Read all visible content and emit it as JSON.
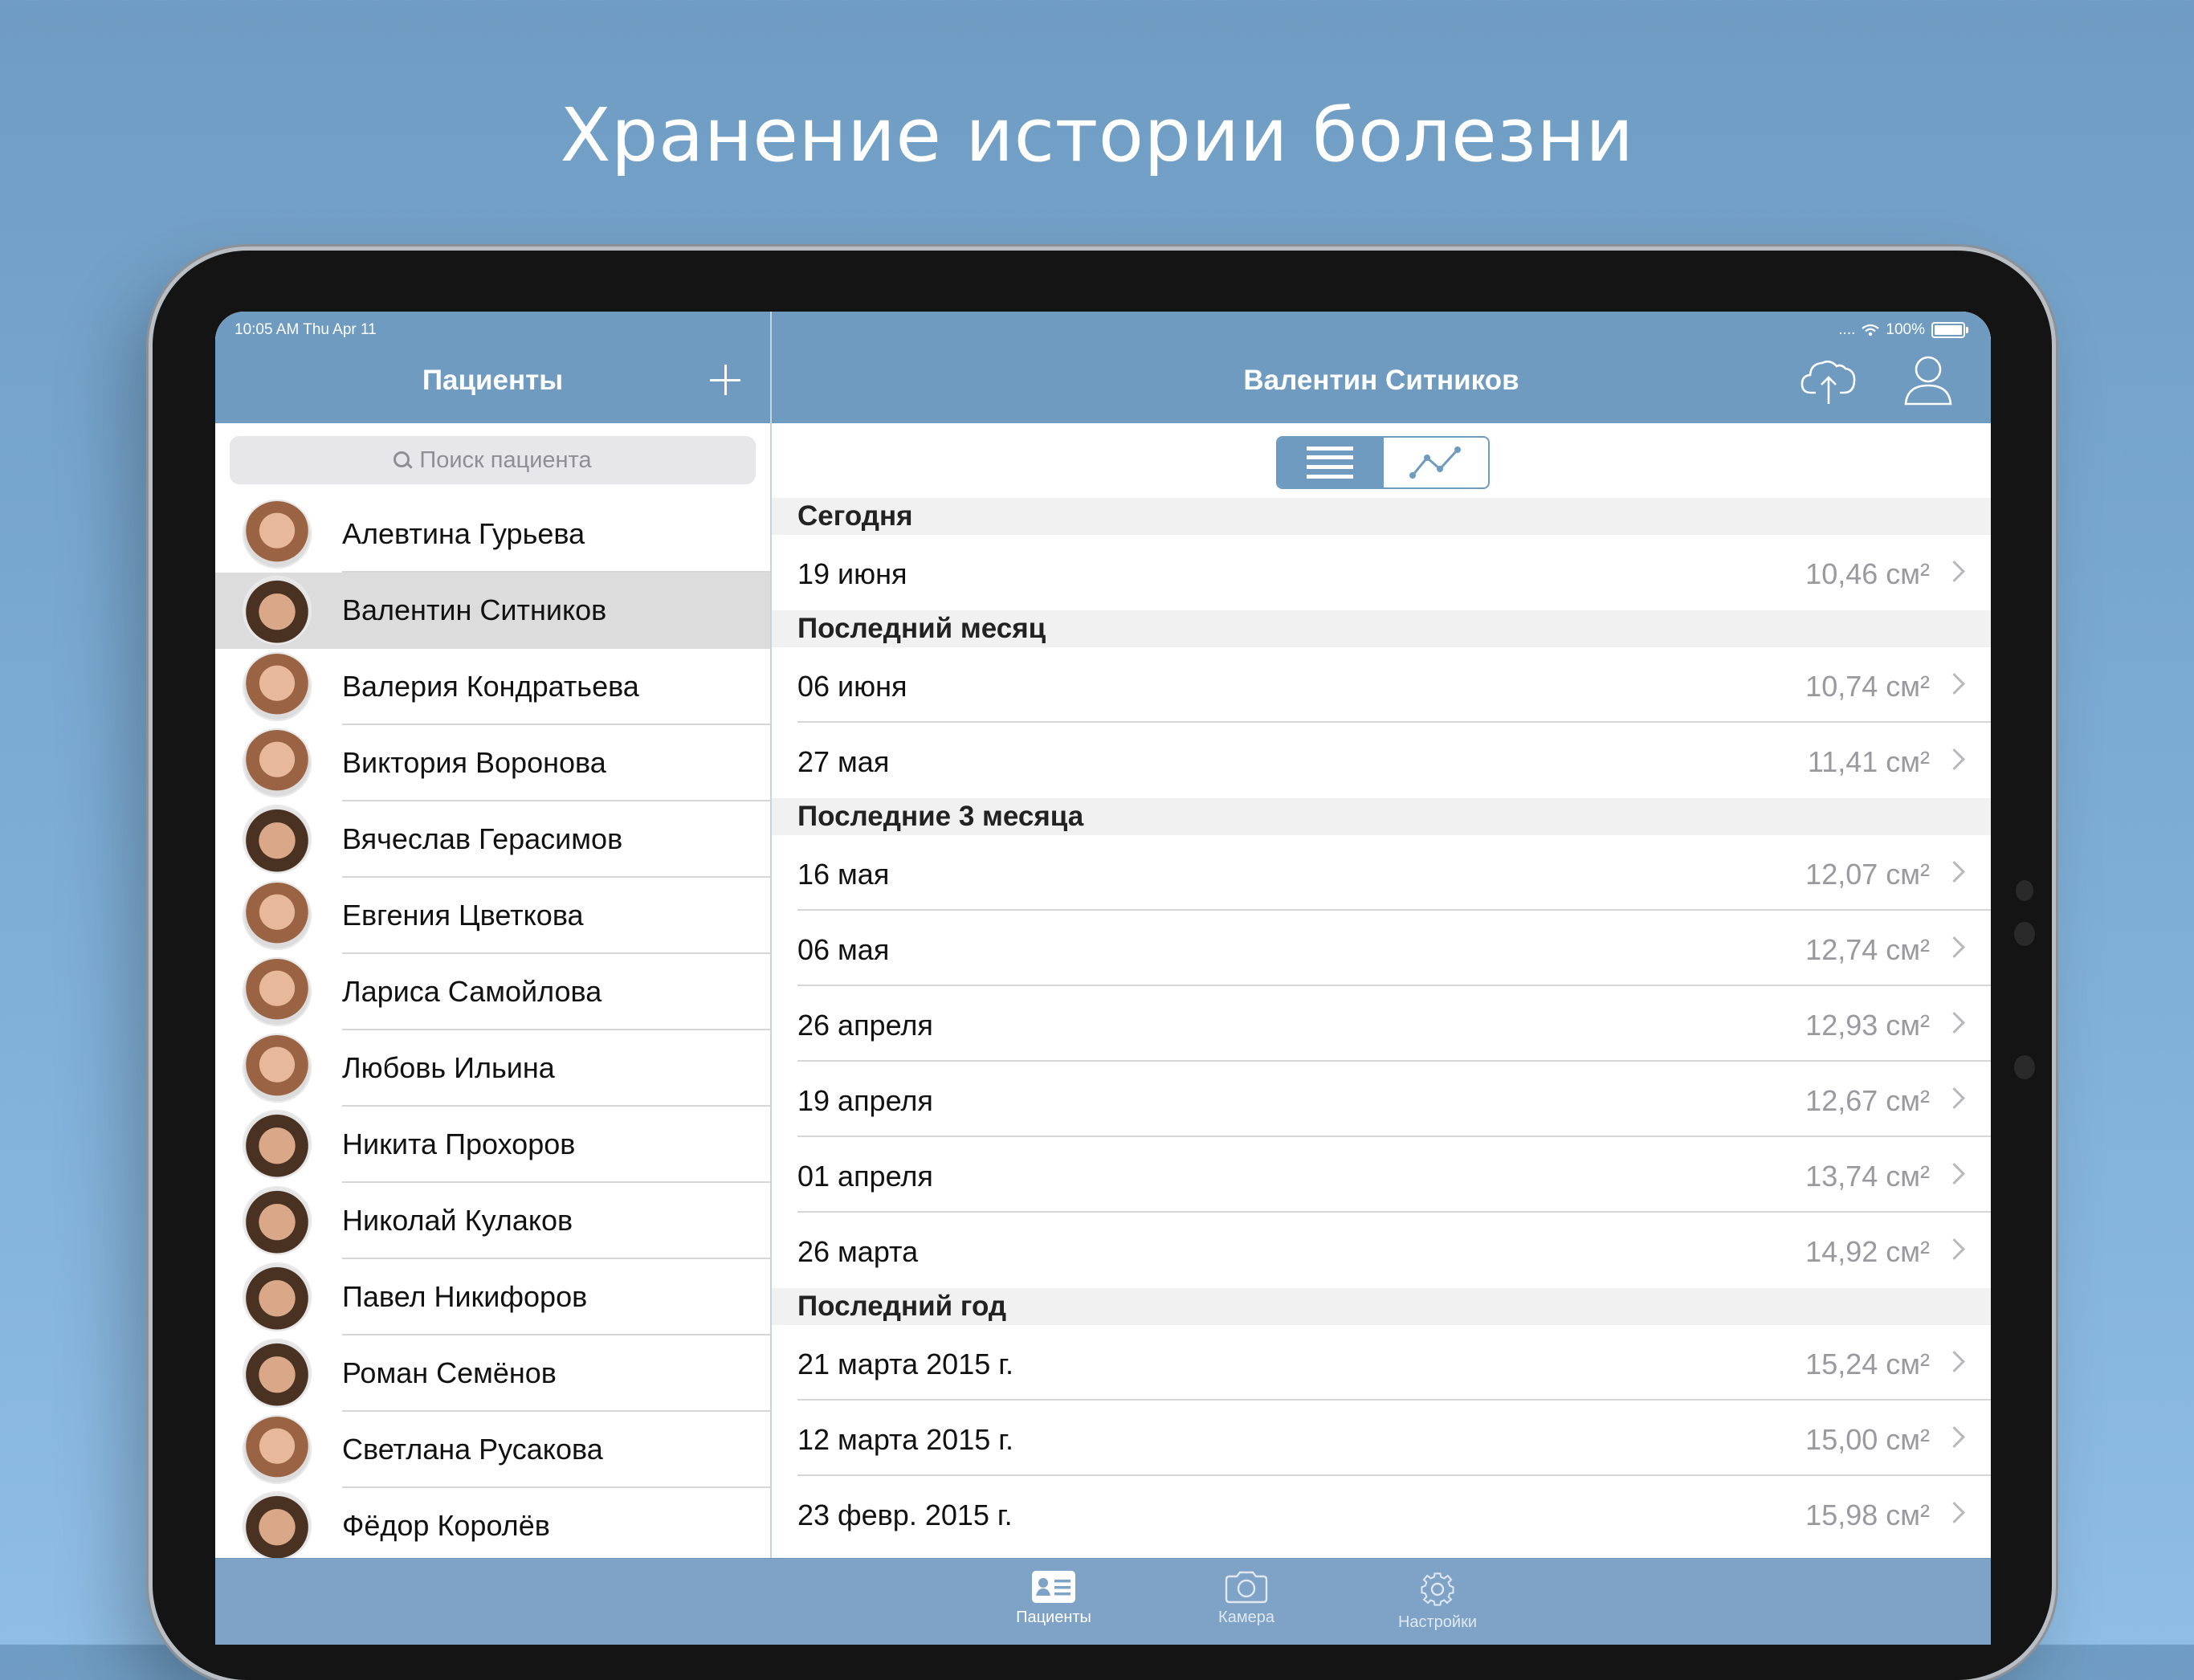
{
  "headline": "Хранение истории болезни",
  "status": {
    "time": "10:05 AM  Thu Apr 11",
    "signal": "....",
    "battery": "100%"
  },
  "left": {
    "title": "Пациенты",
    "search_placeholder": "Поиск пациента",
    "patients": [
      {
        "name": "Алевтина Гурьева",
        "selected": false
      },
      {
        "name": "Валентин Ситников",
        "selected": true
      },
      {
        "name": "Валерия Кондратьева",
        "selected": false
      },
      {
        "name": "Виктория Воронова",
        "selected": false
      },
      {
        "name": "Вячеслав Герасимов",
        "selected": false
      },
      {
        "name": "Евгения Цветкова",
        "selected": false
      },
      {
        "name": "Лариса Самойлова",
        "selected": false
      },
      {
        "name": "Любовь Ильина",
        "selected": false
      },
      {
        "name": "Никита Прохоров",
        "selected": false
      },
      {
        "name": "Николай Кулаков",
        "selected": false
      },
      {
        "name": "Павел Никифоров",
        "selected": false
      },
      {
        "name": "Роман Семёнов",
        "selected": false
      },
      {
        "name": "Светлана Русакова",
        "selected": false
      },
      {
        "name": "Фёдор Королёв",
        "selected": false
      }
    ]
  },
  "right": {
    "title": "Валентин Ситников",
    "sections": [
      {
        "title": "Сегодня",
        "rows": [
          {
            "date": "19 июня",
            "value": "10,46 см²"
          }
        ]
      },
      {
        "title": "Последний месяц",
        "rows": [
          {
            "date": "06 июня",
            "value": "10,74 см²"
          },
          {
            "date": "27 мая",
            "value": "11,41 см²"
          }
        ]
      },
      {
        "title": "Последние 3 месяца",
        "rows": [
          {
            "date": "16 мая",
            "value": "12,07 см²"
          },
          {
            "date": "06 мая",
            "value": "12,74 см²"
          },
          {
            "date": "26 апреля",
            "value": "12,93 см²"
          },
          {
            "date": "19 апреля",
            "value": "12,67 см²"
          },
          {
            "date": "01 апреля",
            "value": "13,74 см²"
          },
          {
            "date": "26 марта",
            "value": "14,92 см²"
          }
        ]
      },
      {
        "title": "Последний год",
        "rows": [
          {
            "date": "21 марта 2015 г.",
            "value": "15,24 см²"
          },
          {
            "date": "12 марта 2015 г.",
            "value": "15,00 см²"
          },
          {
            "date": "23 февр. 2015 г.",
            "value": "15,98 см²"
          }
        ]
      }
    ]
  },
  "tabs": [
    {
      "label": "Пациенты",
      "icon": "patient-card-icon",
      "active": true
    },
    {
      "label": "Камера",
      "icon": "camera-icon",
      "active": false
    },
    {
      "label": "Настройки",
      "icon": "gear-icon",
      "active": false
    }
  ],
  "colors": {
    "accent": "#6f9bc1",
    "background": "#7eaed6",
    "tabbar": "#7fa3c6"
  }
}
